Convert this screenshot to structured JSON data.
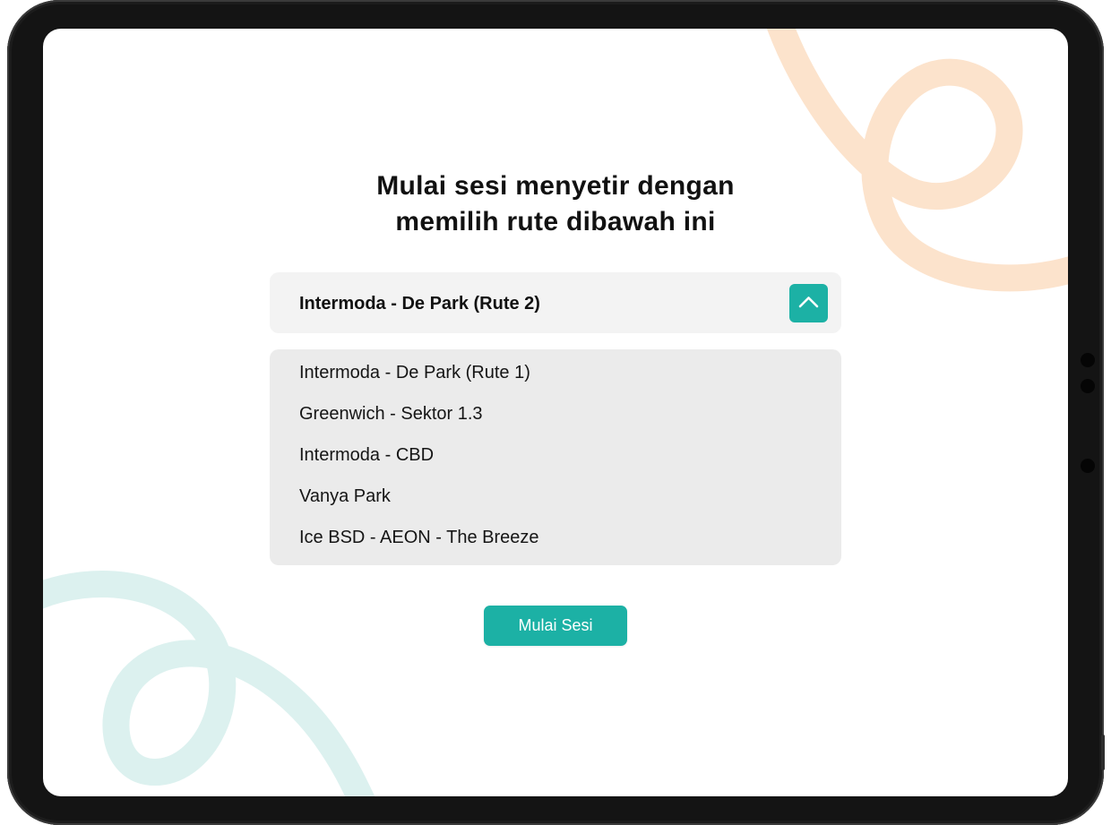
{
  "page": {
    "title_line1": "Mulai sesi menyetir dengan",
    "title_line2": "memilih rute dibawah ini"
  },
  "route_select": {
    "selected": "Intermoda - De Park (Rute 2)",
    "toggle_icon": "chevron-up-icon",
    "expanded": true,
    "options": [
      "Intermoda - De Park (Rute 1)",
      "Greenwich - Sektor 1.3",
      "Intermoda - CBD",
      "Vanya Park",
      "Ice BSD - AEON - The Breeze"
    ]
  },
  "actions": {
    "start_label": "Mulai Sesi"
  },
  "colors": {
    "accent": "#1cb1a5",
    "select_bg": "#f3f3f3",
    "options_bg": "#ebebeb",
    "deco_orange": "#fce3cc",
    "deco_teal": "#dcf1ef"
  }
}
